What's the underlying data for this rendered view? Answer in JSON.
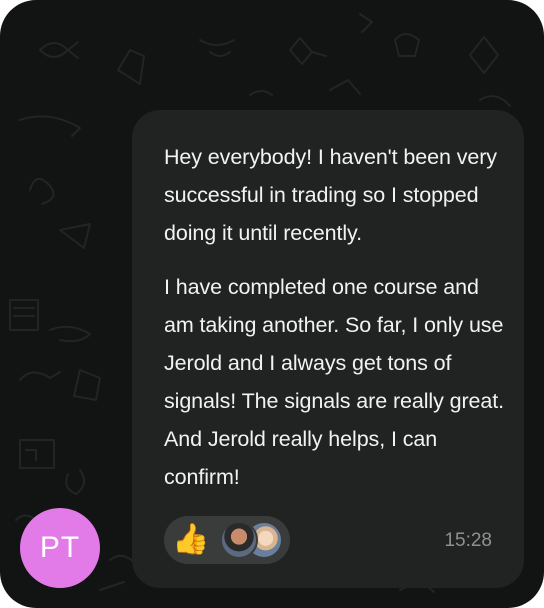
{
  "message": {
    "paragraphs": [
      "Hey everybody! I haven't been very successful in trading so I stopped doing it until recently.",
      "I have completed one course and am taking another. So far, I only use Jerold and I always get tons of signals! The signals are really great. And Jerold really helps, I can confirm!"
    ],
    "time": "15:28"
  },
  "reactions": {
    "emoji": "👍",
    "reactor_count": 2
  },
  "sender": {
    "initials": "PT",
    "avatar_color": "#e27ae8"
  },
  "colors": {
    "background": "#121313",
    "bubble": "#212322",
    "reaction_pill": "#3a3c3b",
    "text": "#f2f2f2",
    "timestamp": "#8f9190"
  }
}
